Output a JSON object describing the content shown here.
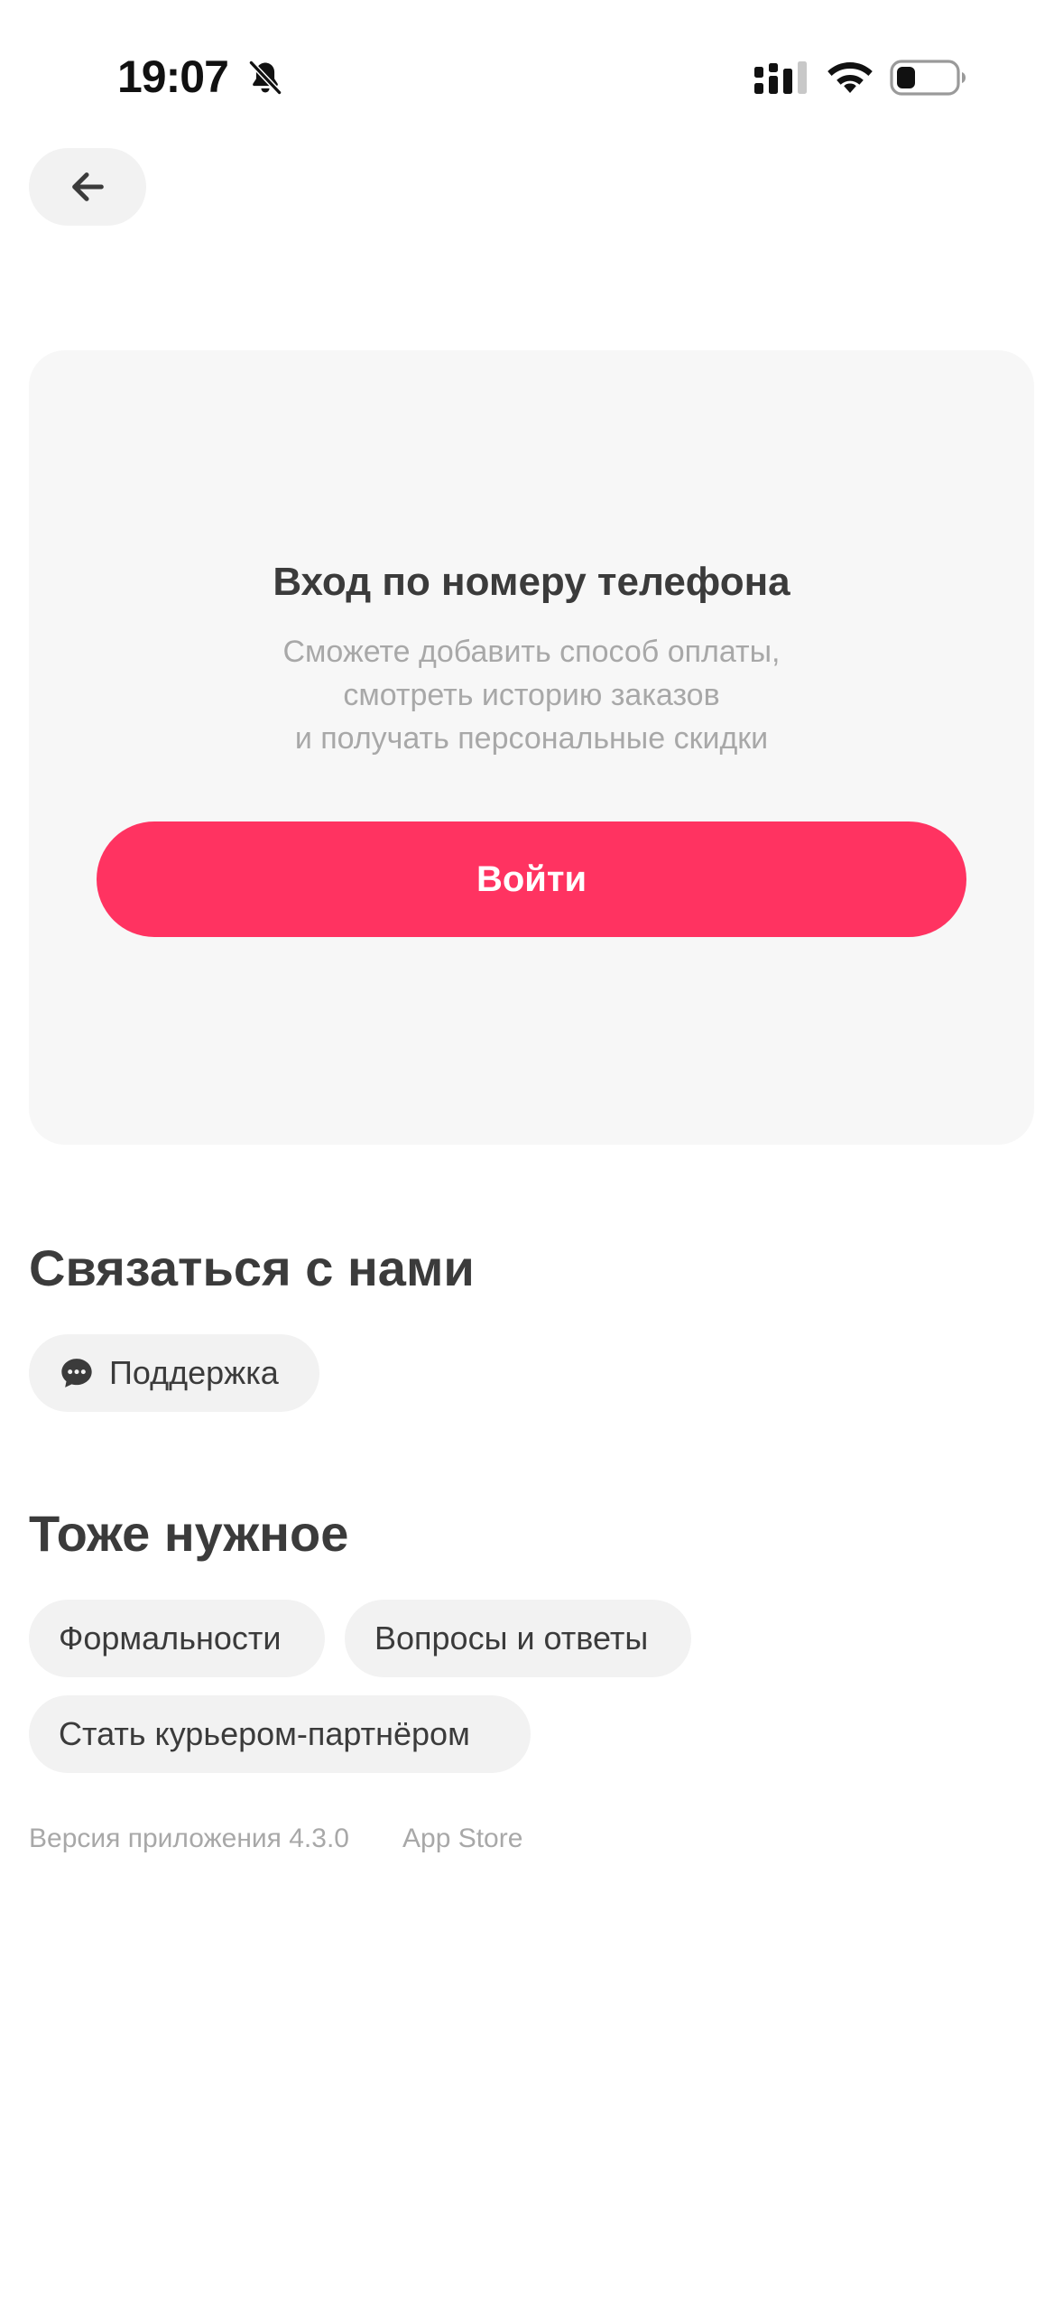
{
  "status_bar": {
    "time": "19:07",
    "icons": [
      "bell-slash-icon",
      "cellular-signal-icon",
      "wifi-icon",
      "battery-icon"
    ]
  },
  "header": {
    "back_icon": "arrow-left-icon"
  },
  "login_card": {
    "title": "Вход по номеру телефона",
    "subtitle_lines": [
      "Сможете добавить способ оплаты,",
      "смотреть историю заказов",
      "и получать персональные скидки"
    ],
    "button_label": "Войти"
  },
  "contact_section": {
    "title": "Связаться с нами",
    "support_label": "Поддержка",
    "support_icon": "chat-bubble-icon"
  },
  "other_section": {
    "title": "Тоже нужное",
    "chips": [
      "Формальности",
      "Вопросы и ответы",
      "Стать курьером-партнёром"
    ]
  },
  "footer": {
    "version": "Версия приложения 4.3.0",
    "store": "App Store"
  },
  "colors": {
    "accent": "#ff3361",
    "card_bg": "#f7f7f7",
    "chip_bg": "#f2f2f2",
    "text": "#3b3b3b",
    "muted": "#a8a8a8"
  }
}
